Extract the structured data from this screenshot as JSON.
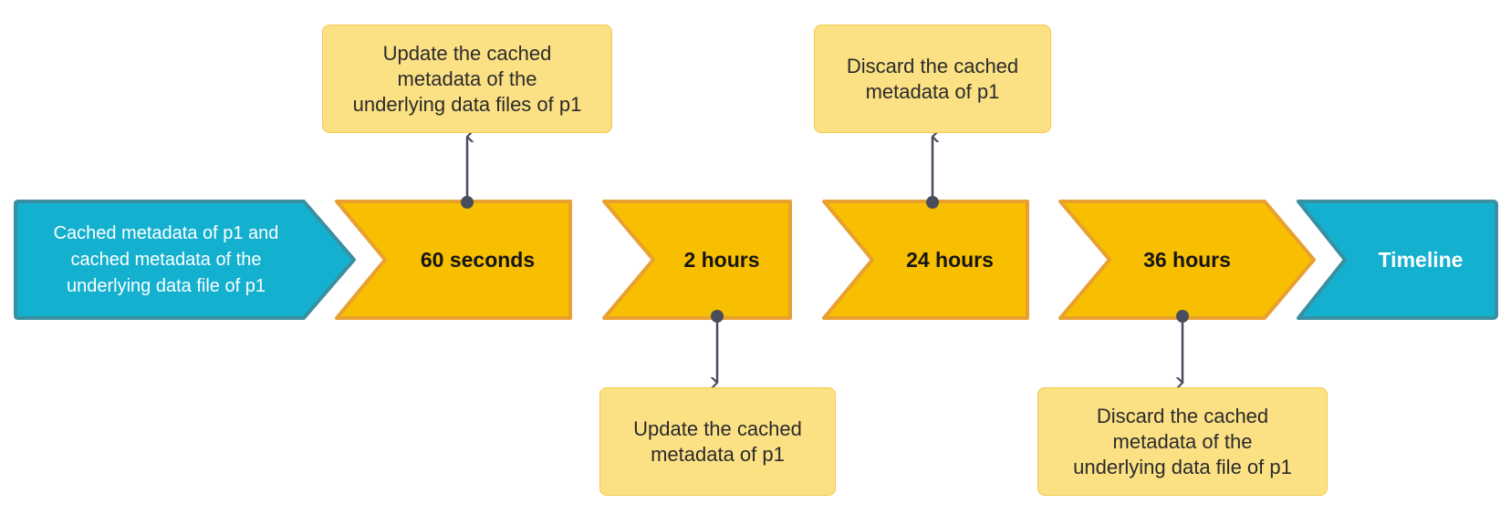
{
  "colors": {
    "step_fill": "#f8be00",
    "step_stroke": "#e8a030",
    "endpoint_fill": "#14b0cf",
    "endpoint_stroke": "#3a8fa0",
    "note_fill": "#fbe084",
    "note_stroke": "#f2c94c",
    "connector": "#474d5a"
  },
  "timeline": {
    "start": {
      "label": "Cached metadata of p1 and\ncached metadata of the\nunderlying data file of p1"
    },
    "steps": [
      {
        "label": "60 seconds"
      },
      {
        "label": "2 hours"
      },
      {
        "label": "24 hours"
      },
      {
        "label": "36 hours"
      }
    ],
    "end": {
      "label": "Timeline"
    }
  },
  "events": [
    {
      "step": "60 seconds",
      "position": "above",
      "text": "Update the cached\nmetadata of the\nunderlying data files of p1"
    },
    {
      "step": "2 hours",
      "position": "below",
      "text": "Update the cached\nmetadata of p1"
    },
    {
      "step": "24 hours",
      "position": "above",
      "text": "Discard the cached\nmetadata of p1"
    },
    {
      "step": "36 hours",
      "position": "below",
      "text": "Discard the cached\nmetadata of the\nunderlying data file of p1"
    }
  ]
}
